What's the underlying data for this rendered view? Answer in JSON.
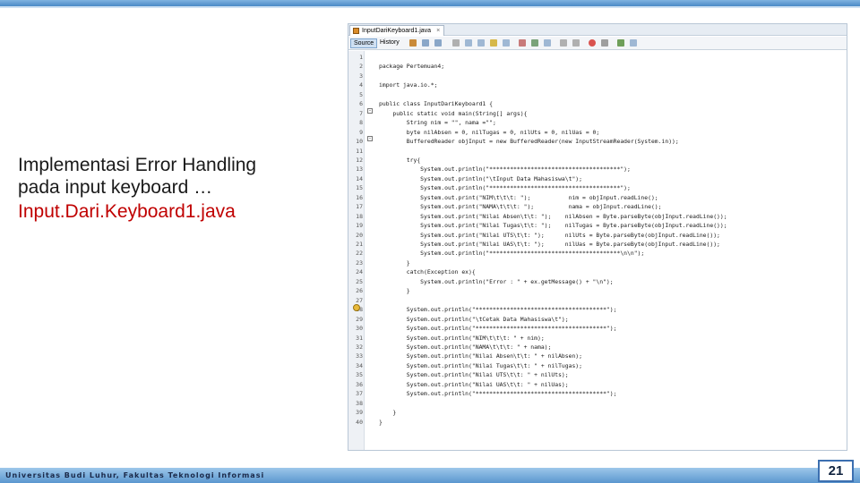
{
  "slide": {
    "title_line1": "Implementasi Error Handling",
    "title_line2": "pada input keyboard …",
    "filename": "Input.Dari.Keyboard1.java",
    "footer": "Universitas Budi Luhur, Fakultas Teknologi Informasi",
    "page_number": "21"
  },
  "ide": {
    "tab_label": "InputDariKeyboard1.java",
    "tab_close": "×",
    "toolbar": {
      "source_label": "Source",
      "history_label": "History"
    },
    "code_lines": [
      "",
      "package Pertemuan4;",
      "",
      "import java.io.*;",
      "",
      "public class InputDariKeyboard1 {",
      "    public static void main(String[] args){",
      "        String nim = \"\", nama =\"\";",
      "        byte nilAbsen = 0, nilTugas = 0, nilUts = 0, nilUas = 0;",
      "        BufferedReader objInput = new BufferedReader(new InputStreamReader(System.in));",
      "",
      "        try{",
      "            System.out.println(\"**************************************\");",
      "            System.out.println(\"\\tInput Data Mahasiswa\\t\");",
      "            System.out.println(\"**************************************\");",
      "            System.out.print(\"NIM\\t\\t\\t: \");           nim = objInput.readLine();",
      "            System.out.print(\"NAMA\\t\\t\\t: \");          nama = objInput.readLine();",
      "            System.out.print(\"Nilai Absen\\t\\t: \");    nilAbsen = Byte.parseByte(objInput.readLine());",
      "            System.out.print(\"Nilai Tugas\\t\\t: \");    nilTugas = Byte.parseByte(objInput.readLine());",
      "            System.out.print(\"Nilai UTS\\t\\t: \");      nilUts = Byte.parseByte(objInput.readLine());",
      "            System.out.print(\"Nilai UAS\\t\\t: \");      nilUas = Byte.parseByte(objInput.readLine());",
      "            System.out.println(\"**************************************\\n\\n\");",
      "        }",
      "        catch(Exception ex){",
      "            System.out.println(\"Error : \" + ex.getMessage() + \"\\n\");",
      "        }",
      "",
      "        System.out.println(\"**************************************\");",
      "        System.out.println(\"\\tCetak Data Mahasiswa\\t\");",
      "        System.out.println(\"**************************************\");",
      "        System.out.println(\"NIM\\t\\t\\t: \" + nim);",
      "        System.out.println(\"NAMA\\t\\t\\t: \" + nama);",
      "        System.out.println(\"Nilai Absen\\t\\t: \" + nilAbsen);",
      "        System.out.println(\"Nilai Tugas\\t\\t: \" + nilTugas);",
      "        System.out.println(\"Nilai UTS\\t\\t: \" + nilUts);",
      "        System.out.println(\"Nilai UAS\\t\\t: \" + nilUas);",
      "        System.out.println(\"**************************************\");",
      "",
      "    }",
      "}"
    ]
  }
}
